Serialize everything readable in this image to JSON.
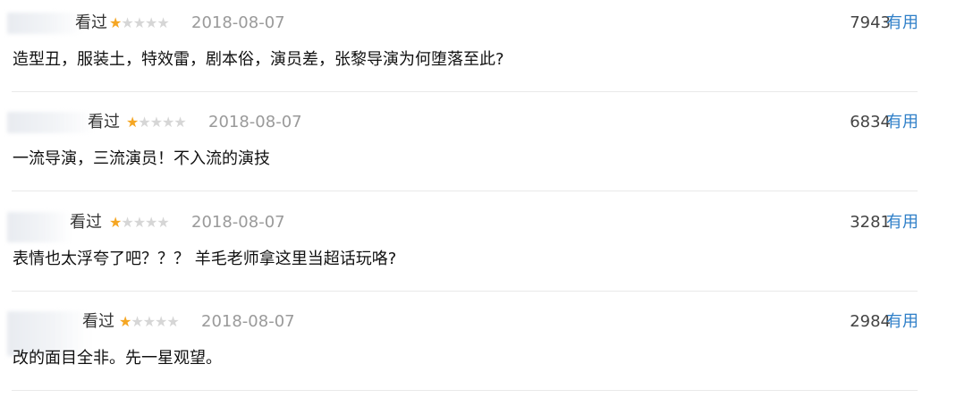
{
  "reviews": [
    {
      "watched": "看过",
      "rating": 1,
      "max": 5,
      "date": "2018-08-07",
      "votes": "7943",
      "useful": "有用",
      "content": "造型丑，服装土，特效雷，剧本俗，演员差，张黎导演为何堕落至此?"
    },
    {
      "watched": "看过",
      "rating": 1,
      "max": 5,
      "date": "2018-08-07",
      "votes": "6834",
      "useful": "有用",
      "content": "一流导演，三流演员！不入流的演技"
    },
    {
      "watched": "看过",
      "rating": 1,
      "max": 5,
      "date": "2018-08-07",
      "votes": "3281",
      "useful": "有用",
      "content": "表情也太浮夸了吧？？？ 羊毛老师拿这里当超话玩咯?"
    },
    {
      "watched": "看过",
      "rating": 1,
      "max": 5,
      "date": "2018-08-07",
      "votes": "2984",
      "useful": "有用",
      "content": "改的面目全非。先一星观望。"
    }
  ],
  "colors": {
    "star_on": "#f5a623",
    "star_off": "#d6d6d6",
    "useful_link": "#2f7fc8",
    "date": "#9a9a9a"
  }
}
